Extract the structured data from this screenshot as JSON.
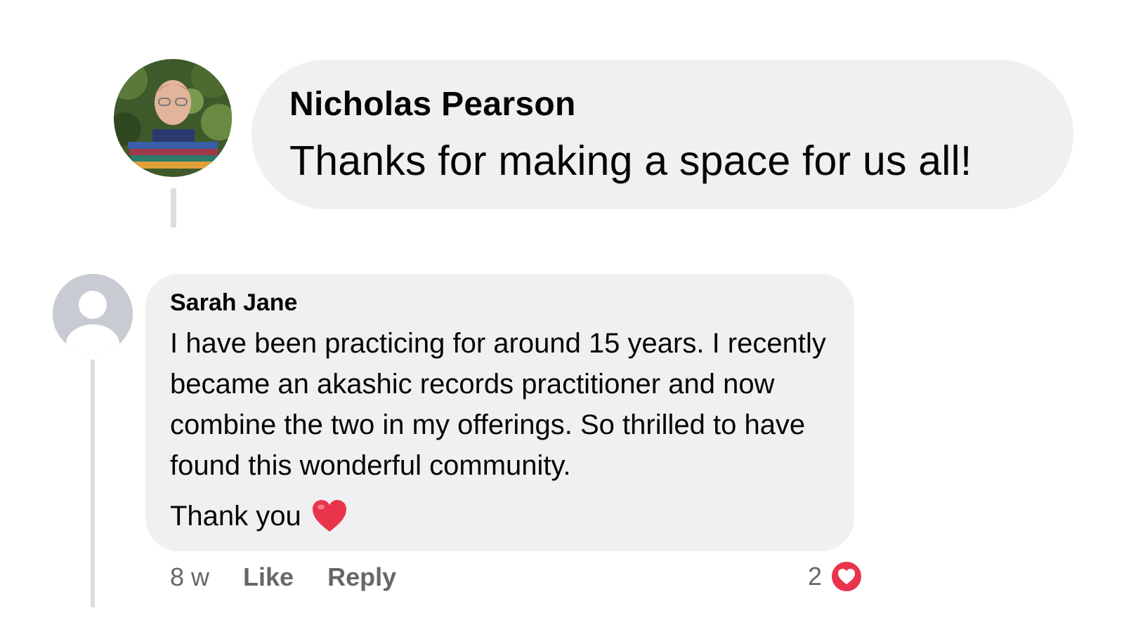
{
  "comments": [
    {
      "author": "Nicholas Pearson",
      "text": "Thanks for making a space for us all!",
      "avatar": "profile-photo"
    },
    {
      "author": "Sarah Jane",
      "text": "I have been practicing for around 15 years. I recently became an akashic records practitioner and now combine the two in my offerings.  So thrilled to have found this wonderful community.",
      "closing": "Thank you",
      "closing_emoji": "red-heart",
      "avatar": "default-avatar",
      "time": "8 w",
      "like_label": "Like",
      "reply_label": "Reply",
      "reaction_count": "2",
      "reaction_icon": "love-reaction"
    }
  ],
  "colors": {
    "bubble": "#f0f0f3",
    "meta_text": "#65676b",
    "heart": "#e8354c",
    "thread_line": "#dcdde1"
  }
}
